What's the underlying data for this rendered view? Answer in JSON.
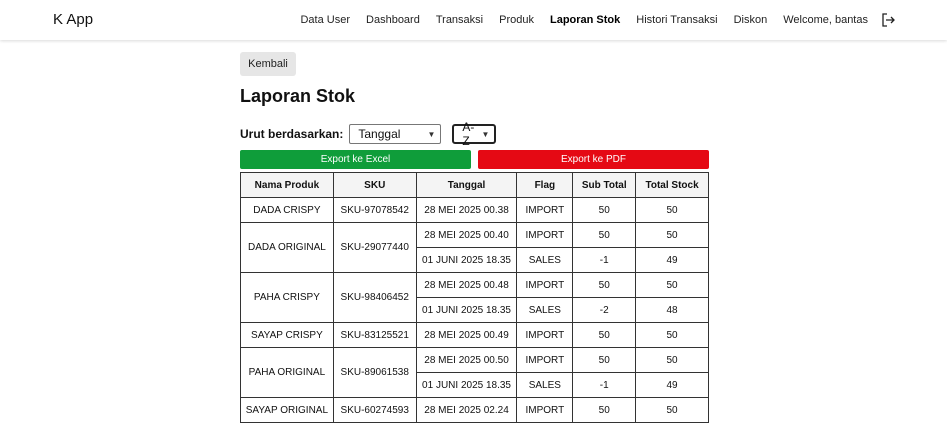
{
  "navbar": {
    "brand": "K App",
    "links": [
      {
        "label": "Data User",
        "active": false
      },
      {
        "label": "Dashboard",
        "active": false
      },
      {
        "label": "Transaksi",
        "active": false
      },
      {
        "label": "Produk",
        "active": false
      },
      {
        "label": "Laporan Stok",
        "active": true
      },
      {
        "label": "Histori Transaksi",
        "active": false
      },
      {
        "label": "Diskon",
        "active": false
      },
      {
        "label": "Welcome, bantas",
        "active": false
      }
    ],
    "logout_icon": "logout-icon"
  },
  "page": {
    "back_label": "Kembali",
    "title": "Laporan Stok",
    "sort_label": "Urut berdasarkan:",
    "sort_field_value": "Tanggal",
    "sort_order_value": "A-Z",
    "export_excel_label": "Export ke Excel",
    "export_pdf_label": "Export ke PDF",
    "colors": {
      "excel": "#0f9d3a",
      "pdf": "#e50914"
    }
  },
  "table": {
    "headers": [
      "Nama Produk",
      "SKU",
      "Tanggal",
      "Flag",
      "Sub Total",
      "Total Stock"
    ],
    "groups": [
      {
        "product": "DADA CRISPY",
        "sku": "SKU-97078542",
        "rows": [
          {
            "date": "28 MEI 2025 00.38",
            "flag": "IMPORT",
            "subtotal": "50",
            "total": "50"
          }
        ]
      },
      {
        "product": "DADA ORIGINAL",
        "sku": "SKU-29077440",
        "rows": [
          {
            "date": "28 MEI 2025 00.40",
            "flag": "IMPORT",
            "subtotal": "50",
            "total": "50"
          },
          {
            "date": "01 JUNI 2025 18.35",
            "flag": "SALES",
            "subtotal": "-1",
            "total": "49"
          }
        ]
      },
      {
        "product": "PAHA CRISPY",
        "sku": "SKU-98406452",
        "rows": [
          {
            "date": "28 MEI 2025 00.48",
            "flag": "IMPORT",
            "subtotal": "50",
            "total": "50"
          },
          {
            "date": "01 JUNI 2025 18.35",
            "flag": "SALES",
            "subtotal": "-2",
            "total": "48"
          }
        ]
      },
      {
        "product": "SAYAP CRISPY",
        "sku": "SKU-83125521",
        "rows": [
          {
            "date": "28 MEI 2025 00.49",
            "flag": "IMPORT",
            "subtotal": "50",
            "total": "50"
          }
        ]
      },
      {
        "product": "PAHA ORIGINAL",
        "sku": "SKU-89061538",
        "rows": [
          {
            "date": "28 MEI 2025 00.50",
            "flag": "IMPORT",
            "subtotal": "50",
            "total": "50"
          },
          {
            "date": "01 JUNI 2025 18.35",
            "flag": "SALES",
            "subtotal": "-1",
            "total": "49"
          }
        ]
      },
      {
        "product": "SAYAP ORIGINAL",
        "sku": "SKU-60274593",
        "rows": [
          {
            "date": "28 MEI 2025 02.24",
            "flag": "IMPORT",
            "subtotal": "50",
            "total": "50"
          }
        ]
      }
    ]
  }
}
